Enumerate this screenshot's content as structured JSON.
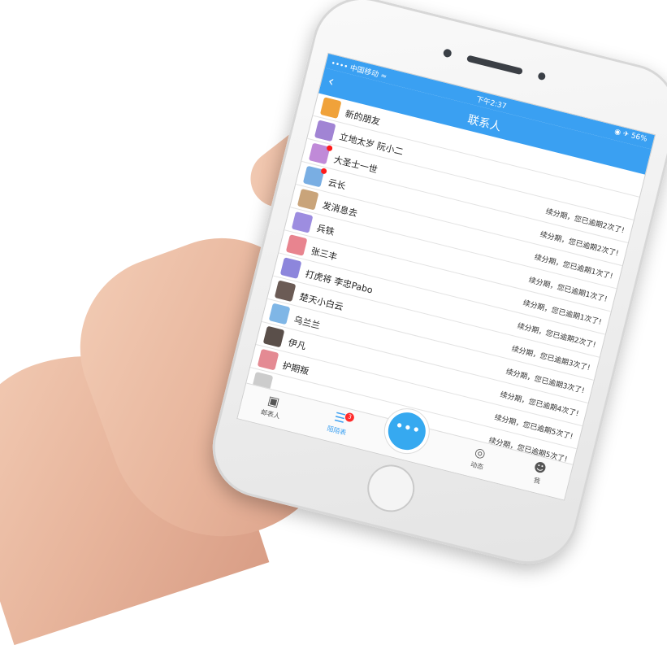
{
  "status_bar": {
    "carrier": "•••• 中国移动 ≈",
    "time": "下午2:37",
    "battery": "◉ ✈ 56%"
  },
  "nav": {
    "back_icon": "chevron-left-icon",
    "title": "联系人"
  },
  "contacts": [
    {
      "name": "新的朋友",
      "status": "",
      "color": "#f0a23a",
      "unread": false
    },
    {
      "name": "立地太岁 阮小二",
      "status": "",
      "color": "#a184d4",
      "unread": false
    },
    {
      "name": "大圣士一世",
      "status": "续分期，您已逾期2次了!",
      "color": "#c08ad8",
      "unread": true
    },
    {
      "name": "云长",
      "status": "续分期，您已逾期2次了!",
      "color": "#79aee3",
      "unread": true
    },
    {
      "name": "发消息去",
      "status": "续分期，您已逾期1次了!",
      "color": "#c9a47a",
      "unread": false
    },
    {
      "name": "兵铁",
      "status": "续分期，您已逾期1次了!",
      "color": "#9d8de0",
      "unread": false
    },
    {
      "name": "张三丰",
      "status": "续分期，您已逾期1次了!",
      "color": "#e8848f",
      "unread": false
    },
    {
      "name": "打虎将 李忠Pabo",
      "status": "续分期，您已逾期2次了!",
      "color": "#8d86dc",
      "unread": false
    },
    {
      "name": "楚天小白云",
      "status": "续分期，您已逾期3次了!",
      "color": "#6b5b55",
      "unread": false
    },
    {
      "name": "乌兰兰",
      "status": "续分期，您已逾期3次了!",
      "color": "#7fb6e6",
      "unread": false
    },
    {
      "name": "伊凡",
      "status": "续分期，您已逾期4次了!",
      "color": "#5a4f4a",
      "unread": false
    },
    {
      "name": "护期叛",
      "status": "续分期，您已逾期5次了!",
      "color": "#e48a93",
      "unread": false
    },
    {
      "name": "",
      "status": "续分期，您已逾期5次了!",
      "color": "#cccccc",
      "unread": false
    }
  ],
  "tabs": [
    {
      "label": "邮表人",
      "icon": "image-icon",
      "badge": ""
    },
    {
      "label": "陌陌表",
      "icon": "list-icon",
      "badge": "3"
    },
    {
      "label": "动态",
      "icon": "target-icon",
      "badge": ""
    },
    {
      "label": "我",
      "icon": "user-icon",
      "badge": ""
    }
  ],
  "center_button": {
    "icon": "more-dots-icon",
    "glyph": "•••"
  }
}
